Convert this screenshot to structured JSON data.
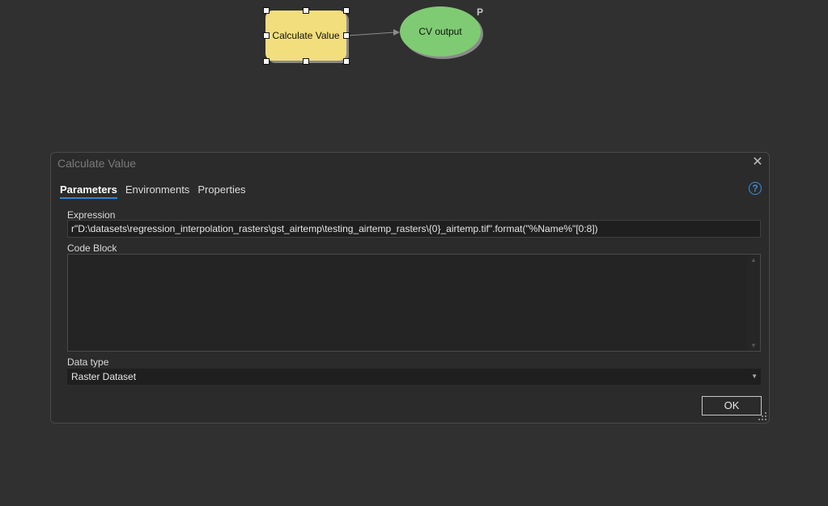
{
  "model": {
    "tool_node_label": "Calculate Value",
    "output_node_label": "CV output",
    "output_parameter_marker": "P"
  },
  "dialog": {
    "title": "Calculate Value",
    "close_icon": "close-icon",
    "help_icon": "help-icon",
    "help_glyph": "?",
    "tabs": [
      {
        "label": "Parameters",
        "active": true
      },
      {
        "label": "Environments",
        "active": false
      },
      {
        "label": "Properties",
        "active": false
      }
    ],
    "expression": {
      "label": "Expression",
      "value": "r\"D:\\datasets\\regression_interpolation_rasters\\gst_airtemp\\testing_airtemp_rasters\\{0}_airtemp.tif\".format(\"%Name%\"[0:8])"
    },
    "code_block": {
      "label": "Code Block",
      "value": ""
    },
    "data_type": {
      "label": "Data type",
      "selected": "Raster Dataset"
    },
    "ok_label": "OK"
  },
  "colors": {
    "tool_fill": "#f2de7c",
    "output_fill": "#7fcb73",
    "accent": "#2e86de"
  }
}
